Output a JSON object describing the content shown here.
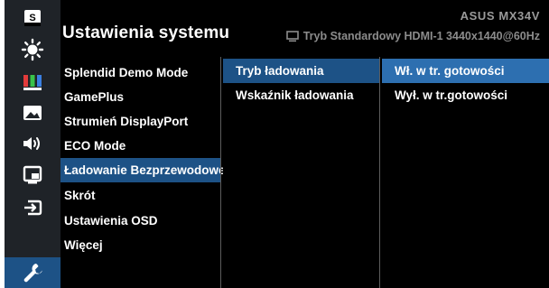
{
  "header": {
    "title": "Ustawienia systemu",
    "model": "ASUS  MX34V",
    "status_icon": "monitor-icon",
    "status": "Tryb Standardowy HDMI-1  3440x1440@60Hz"
  },
  "rail": {
    "items": [
      {
        "icon": "splendid-s-icon"
      },
      {
        "icon": "brightness-icon"
      },
      {
        "icon": "color-bars-icon"
      },
      {
        "icon": "image-icon"
      },
      {
        "icon": "speaker-icon"
      },
      {
        "icon": "pip-icon"
      },
      {
        "icon": "input-select-icon"
      },
      {
        "icon": "wrench-icon",
        "active": true
      }
    ]
  },
  "menu": {
    "level1": [
      "Splendid Demo Mode",
      "GamePlus",
      "Strumień DisplayPort",
      "ECO Mode",
      "Ładowanie Bezprzewodowe",
      "Skrót",
      "Ustawienia OSD",
      "Więcej"
    ],
    "level1_selected": 4,
    "level2": [
      "Tryb ładowania",
      "Wskaźnik ładowania"
    ],
    "level2_selected": 0,
    "level3": [
      "Wł. w tr. gotowości",
      "Wył. w tr.gotowości"
    ],
    "level3_selected": 0
  },
  "colors": {
    "background": "#000000",
    "rail": "#1f2328",
    "selected": "#1d5286",
    "highlight": "#2d6fb0",
    "separator": "#5d5d5d"
  }
}
